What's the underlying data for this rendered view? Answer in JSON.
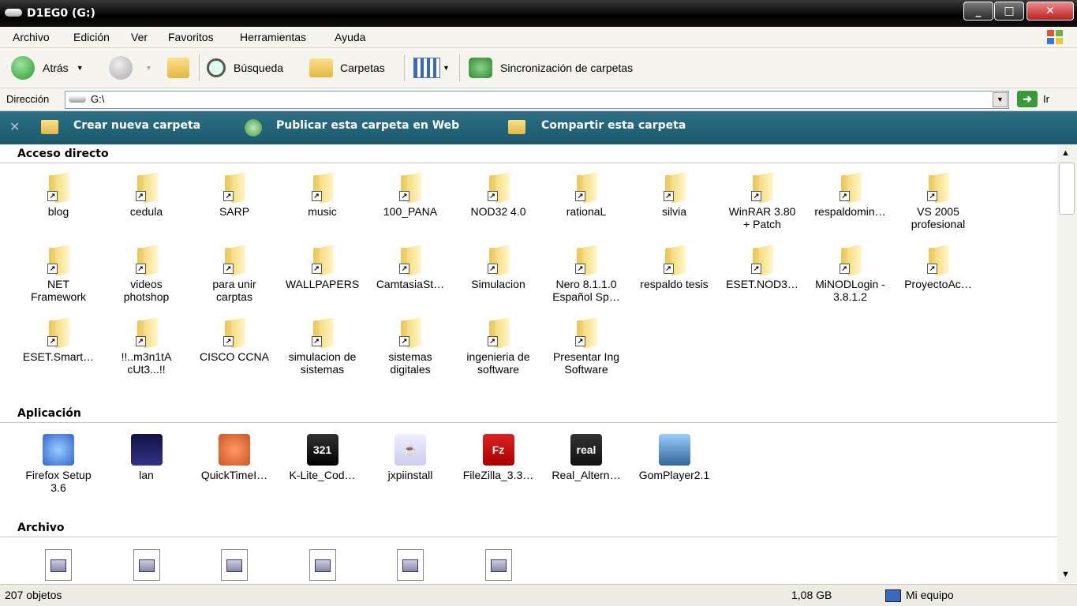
{
  "window": {
    "title": "D1EG0 (G:)"
  },
  "menu": [
    "Archivo",
    "Edición",
    "Ver",
    "Favoritos",
    "Herramientas",
    "Ayuda"
  ],
  "toolbar": {
    "back": "Atrás",
    "search": "Búsqueda",
    "folders": "Carpetas",
    "sync": "Sincronización de carpetas"
  },
  "address": {
    "label": "Dirección",
    "value": "G:\\",
    "go": "Ir"
  },
  "tasks": {
    "new_folder": "Crear nueva carpeta",
    "publish": "Publicar esta carpeta en Web",
    "share": "Compartir esta carpeta"
  },
  "groups": {
    "shortcuts": {
      "title": "Acceso directo",
      "items": [
        "blog",
        "cedula",
        "SARP",
        "music",
        "100_PANA",
        "NOD32 4.0",
        "rationaL",
        "silvia",
        "WinRAR 3.80\n+ Patch",
        "respaldomin…",
        "VS 2005\nprofesional",
        "NET\nFramework",
        "videos\nphotshop",
        "para unir\ncarptas",
        "WALLPAPERS",
        "CamtasiaSt…",
        "Simulacion",
        "Nero 8.1.1.0\nEspañol Sp…",
        "respaldo tesis",
        "ESET.NOD3…",
        "MiNODLogin -\n3.8.1.2",
        "ProyectoAc…",
        "ESET.Smart…",
        "!!..m3n1tA\ncUt3...!!",
        "CISCO CCNA",
        "simulacion de\nsistemas",
        "sistemas\ndigitales",
        "ingenieria de\nsoftware",
        "Presentar Ing\nSoftware"
      ]
    },
    "apps": {
      "title": "Aplicación",
      "items": [
        "Firefox Setup\n3.6",
        "lan",
        "QuickTimeI…",
        "K-Lite_Cod…",
        "jxpiinstall",
        "FileZilla_3.3…",
        "Real_Altern…",
        "GomPlayer2.1"
      ]
    },
    "files": {
      "title": "Archivo"
    }
  },
  "status": {
    "count": "207 objetos",
    "size": "1,08 GB",
    "location": "Mi equipo"
  }
}
